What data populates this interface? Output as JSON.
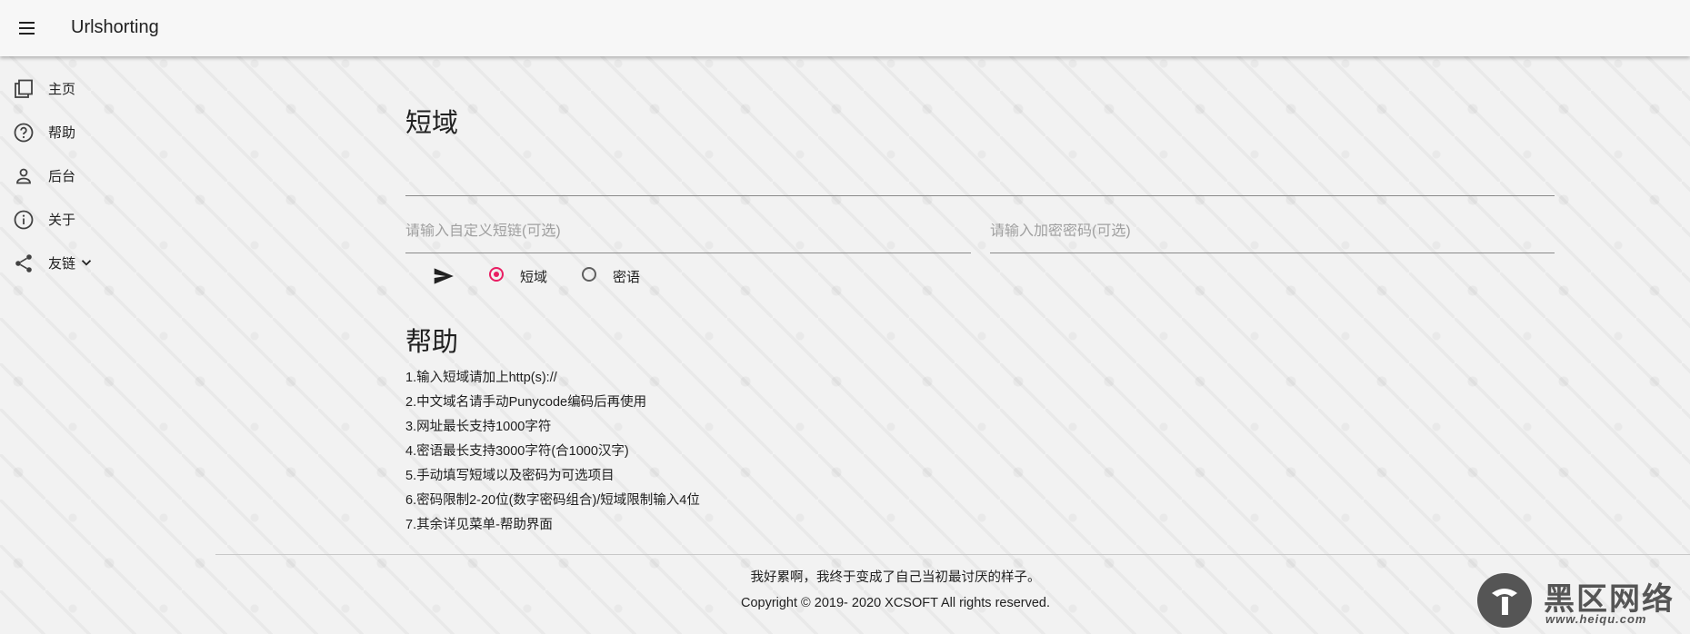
{
  "app": {
    "title": "Urlshorting"
  },
  "sidebar": {
    "items": [
      {
        "label": "主页",
        "icon": "pages-icon"
      },
      {
        "label": "帮助",
        "icon": "help-circle-icon"
      },
      {
        "label": "后台",
        "icon": "person-icon"
      },
      {
        "label": "关于",
        "icon": "info-icon"
      },
      {
        "label": "友链",
        "icon": "share-icon",
        "expandable": true
      }
    ]
  },
  "main": {
    "shorten_title": "短域",
    "url_input_value": "",
    "custom_short_placeholder": "请输入自定义短链(可选)",
    "password_placeholder": "请输入加密密码(可选)",
    "send_icon": "send-icon",
    "modes": [
      {
        "label": "短域",
        "checked": true
      },
      {
        "label": "密语",
        "checked": false
      }
    ],
    "help_title": "帮助",
    "help_items": [
      "1.输入短域请加上http(s)://",
      "2.中文域名请手动Punycode编码后再使用",
      "3.网址最长支持1000字符",
      "4.密语最长支持3000字符(合1000汉字)",
      "5.手动填写短域以及密码为可选项目",
      "6.密码限制2-20位(数字密码组合)/短域限制输入4位",
      "7.其余详见菜单-帮助界面"
    ]
  },
  "footer": {
    "motto": "我好累啊，我终于变成了自己当初最讨厌的样子。",
    "copyright": "Copyright © 2019- 2020 XCSOFT All rights reserved."
  },
  "watermark": {
    "text": "黑区网络",
    "url": "www.heiqu.com"
  },
  "colors": {
    "accent": "#e91e63",
    "background": "#f2f2f2",
    "text": "#212121"
  }
}
